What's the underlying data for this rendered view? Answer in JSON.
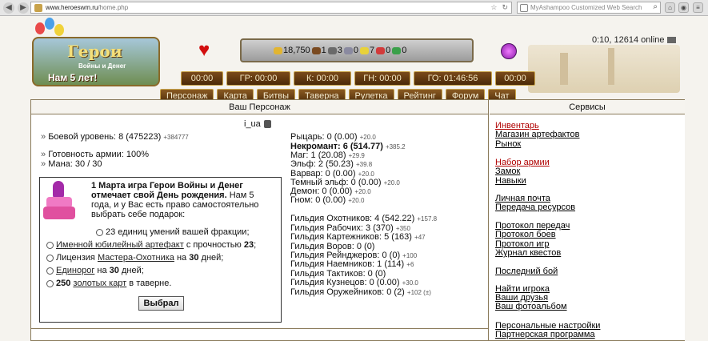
{
  "browser": {
    "url_host": "www.heroeswm.ru",
    "url_path": "/home.php",
    "search_placeholder": "MyAshampoo Customized Web Search"
  },
  "header": {
    "logo_title": "Герои",
    "logo_subtitle": "Войны и Денег",
    "logo_anniversary": "Нам 5 лет!",
    "resources": [
      "18,750",
      "1",
      "3",
      "0",
      "7",
      "0",
      "0"
    ],
    "online": "0:10, 12614 online",
    "timers": [
      "00:00",
      "ГР: 00:00",
      "К: 00:00",
      "ГН: 00:00",
      "ГО: 01:46:56",
      "00:00"
    ],
    "menu": [
      "Персонаж",
      "Карта",
      "Битвы",
      "Таверна",
      "Рулетка",
      "Рейтинг",
      "Форум",
      "Чат"
    ]
  },
  "left": {
    "heading": "Ваш Персонаж",
    "player_name": "i_ua",
    "combat_label": "Боевой уровень:",
    "combat_value": "8",
    "combat_exp": "(475223)",
    "combat_plus": "+384777",
    "army_label": "Готовность армии:",
    "army_value": "100%",
    "mana_label": "Мана:",
    "mana_value": "30 / 30",
    "bday": {
      "line1": "1 Марта игра Герои Войны и Денег",
      "line2": "отмечает свой День рождения.",
      "line2b": "Нам 5",
      "line3": "года, и у Вас есть право самостоятельно",
      "line4": "выбрать себе подарок:",
      "opt1": "23 единиц умений вашей фракции;",
      "opt2_link": "Именной юбилейный артефакт",
      "opt2_rest": "с прочностью",
      "opt2_num": "23",
      "opt3_a": "Лицензия",
      "opt3_link": "Мастера-Охотника",
      "opt3_b": "на",
      "opt3_num": "30",
      "opt3_c": "дней;",
      "opt4_link": "Единорог",
      "opt4_a": "на",
      "opt4_num": "30",
      "opt4_b": "дней;",
      "opt5_num": "250",
      "opt5_link": "золотых карт",
      "opt5_rest": "в таверне.",
      "button": "Выбрал"
    },
    "factions": [
      {
        "text": "Рыцарь: 0 (0.00)",
        "plus": "+20.0"
      },
      {
        "text": "Некромант: 6 (514.77)",
        "plus": "+385.2"
      },
      {
        "text": "Маг: 1 (20.08)",
        "plus": "+29.9"
      },
      {
        "text": "Эльф: 2 (50.23)",
        "plus": "+39.8"
      },
      {
        "text": "Варвар: 0 (0.00)",
        "plus": "+20.0"
      },
      {
        "text": "Темный эльф: 0 (0.00)",
        "plus": "+20.0"
      },
      {
        "text": "Демон: 0 (0.00)",
        "plus": "+20.0"
      },
      {
        "text": "Гном: 0 (0.00)",
        "plus": "+20.0"
      }
    ],
    "guilds": [
      {
        "text": "Гильдия Охотников: 4 (542.22)",
        "plus": "+157.8"
      },
      {
        "text": "Гильдия Рабочих: 3 (370)",
        "plus": "+350"
      },
      {
        "text": "Гильдия Картежников: 5 (163)",
        "plus": "+47"
      },
      {
        "text": "Гильдия Воров: 0 (0)",
        "plus": ""
      },
      {
        "text": "Гильдия Рейнджеров: 0 (0)",
        "plus": "+100"
      },
      {
        "text": "Гильдия Наемников: 1 (114)",
        "plus": "+6"
      },
      {
        "text": "Гильдия Тактиков: 0 (0)",
        "plus": ""
      },
      {
        "text": "Гильдия Кузнецов: 0 (0.00)",
        "plus": "+30.0"
      },
      {
        "text": "Гильдия Оружейников: 0 (2)",
        "plus": "+102 (±)"
      }
    ]
  },
  "right": {
    "heading": "Сервисы",
    "links": [
      "Инвентарь",
      "Магазин артефактов",
      "Рынок",
      "Набор армии",
      "Замок",
      "Навыки",
      "Личная почта",
      "Передача ресурсов",
      "Протокол передач",
      "Протокол боев",
      "Протокол игр",
      "Журнал квестов",
      "Последний бой",
      "Найти игрока",
      "Ваши друзья",
      "Ваш фотоальбом",
      "Персональные настройки",
      "Партнерская программа"
    ]
  },
  "colors": {
    "link_red": "#b00000",
    "menu_bg": "#6b3f12",
    "timer_text": "#f4e7c2"
  }
}
